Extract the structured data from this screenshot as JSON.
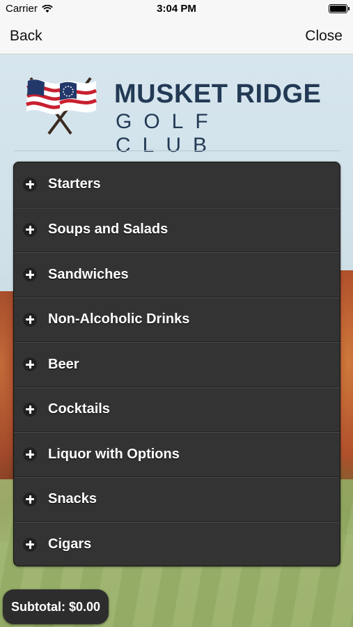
{
  "status_bar": {
    "carrier": "Carrier",
    "time": "3:04 PM",
    "battery_level": 0.9
  },
  "nav": {
    "back_label": "Back",
    "close_label": "Close"
  },
  "logo": {
    "title": "MUSKET RIDGE",
    "subtitle": "GOLF CLUB"
  },
  "menu": {
    "items": [
      {
        "label": "Starters"
      },
      {
        "label": "Soups and Salads"
      },
      {
        "label": "Sandwiches"
      },
      {
        "label": "Non-Alcoholic Drinks"
      },
      {
        "label": "Beer"
      },
      {
        "label": "Cocktails"
      },
      {
        "label": "Liquor with Options"
      },
      {
        "label": "Snacks"
      },
      {
        "label": "Cigars"
      }
    ]
  },
  "subtotal": {
    "text": "Subtotal: $0.00"
  },
  "colors": {
    "menu_bg": "#333333",
    "brand_navy": "#233a55",
    "flag_red": "#c8202f"
  }
}
